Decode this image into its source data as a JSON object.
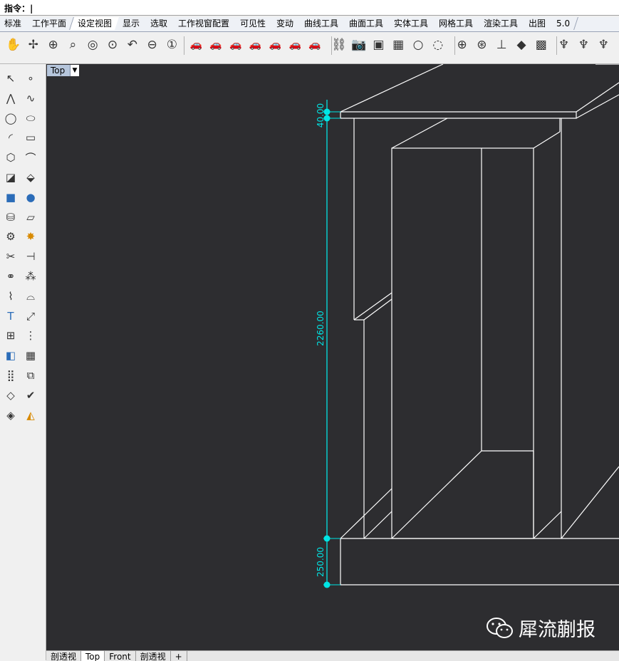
{
  "command": {
    "label": "指令：|"
  },
  "tabs": [
    {
      "label": "标准"
    },
    {
      "label": "工作平面"
    },
    {
      "label": "设定视图",
      "active": true
    },
    {
      "label": "显示"
    },
    {
      "label": "选取"
    },
    {
      "label": "工作视窗配置"
    },
    {
      "label": "可见性"
    },
    {
      "label": "变动"
    },
    {
      "label": "曲线工具"
    },
    {
      "label": "曲面工具"
    },
    {
      "label": "实体工具"
    },
    {
      "label": "网格工具"
    },
    {
      "label": "渲染工具"
    },
    {
      "label": "出图"
    },
    {
      "label": "5.0"
    }
  ],
  "viewport": {
    "name": "Top",
    "dimensions": {
      "top": "40.00",
      "middle": "2260.00",
      "bottom": "250.00"
    },
    "dimension_color": "#00e5e5",
    "background": "#2d2d30"
  },
  "bottom_tabs": [
    {
      "label": "剖透视"
    },
    {
      "label": "Top",
      "active": true
    },
    {
      "label": "Front"
    },
    {
      "label": "剖透视"
    },
    {
      "label": "+"
    }
  ],
  "watermark": {
    "text": "犀流蒯报"
  },
  "toolbar_icons": [
    "pan-hand-icon",
    "rotate-view-icon",
    "zoom-icon",
    "zoom-window-icon",
    "zoom-extents-icon",
    "zoom-selected-icon",
    "undo-view-icon",
    "zoom-out-icon",
    "zoom-1to1-icon",
    "red-car-icon",
    "red-car-icon",
    "red-car-icon",
    "red-car-icon",
    "red-car-icon",
    "red-car-icon",
    "red-car-icon",
    "camera-target-icon",
    "camera-icon",
    "named-view-icon",
    "four-views-icon",
    "light-icon",
    "two-lights-icon",
    "osnap-target-icon",
    "osnap-gold-icon",
    "cplane-icon",
    "layer-icon",
    "box-shaded-icon",
    "tripod-icon",
    "tripod-icon",
    "tripod-icon"
  ],
  "left_icons": [
    "select-arrow-icon",
    "point-icon",
    "polyline-icon",
    "curve-pt-icon",
    "circle-icon",
    "ellipse-icon",
    "arc-icon",
    "rectangle-icon",
    "polygon-icon",
    "fillet-curve-icon",
    "surface-corner-icon",
    "extrude-surface-icon",
    "box-solid-icon",
    "sphere-solid-icon",
    "cylinder-icon",
    "plane-icon",
    "gear-icon",
    "explode-icon",
    "trim-icon",
    "split-icon",
    "boolean-union-icon",
    "group-icon",
    "offset-icon",
    "fillet-icon",
    "text-icon",
    "scale-icon",
    "array-icon",
    "mirror-icon",
    "cube-blue-icon",
    "grid-icon",
    "dots-grid-icon",
    "align-icon",
    "edit-pts-icon",
    "check-icon",
    "render-icon",
    "paint-icon"
  ]
}
